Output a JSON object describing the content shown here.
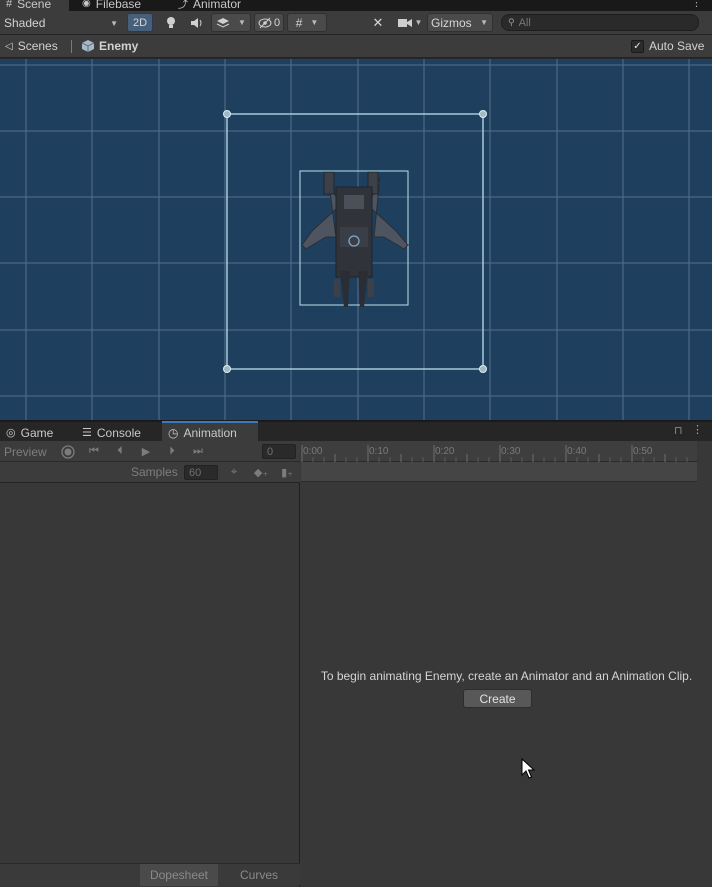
{
  "top_tabs": [
    {
      "label": "Scene",
      "icon": "grid-icon"
    },
    {
      "label": "Filebase",
      "icon": "eye-icon"
    },
    {
      "label": "Animator",
      "icon": "animator-icon"
    }
  ],
  "scene_toolbar": {
    "shading_mode": "Shaded",
    "mode_2d": "2D",
    "hidden_count": "0",
    "gizmos_label": "Gizmos",
    "search_placeholder": "All"
  },
  "breadcrumb": {
    "scenes_label": "Scenes",
    "prefab_label": "Enemy",
    "auto_save_label": "Auto Save",
    "auto_save_checked": true
  },
  "lower_tabs": [
    {
      "label": "Game",
      "icon": "gamepad-icon"
    },
    {
      "label": "Console",
      "icon": "console-icon"
    },
    {
      "label": "Animation",
      "icon": "clock-icon",
      "active": true
    }
  ],
  "animation": {
    "preview_label": "Preview",
    "frame_value": "0",
    "samples_label": "Samples",
    "samples_value": "60",
    "ruler_ticks": [
      "0:00",
      "0:10",
      "0:20",
      "0:30",
      "0:40",
      "0:50"
    ],
    "empty_message": "To begin animating Enemy, create an Animator and an Animation Clip.",
    "create_label": "Create",
    "bottom_tabs": [
      "Dopesheet",
      "Curves"
    ]
  },
  "colors": {
    "scene_bg": "#1f3f5f",
    "grid_line": "#5a7593",
    "selection": "#b8e0ea",
    "active_tab_accent": "#3a79bb"
  }
}
